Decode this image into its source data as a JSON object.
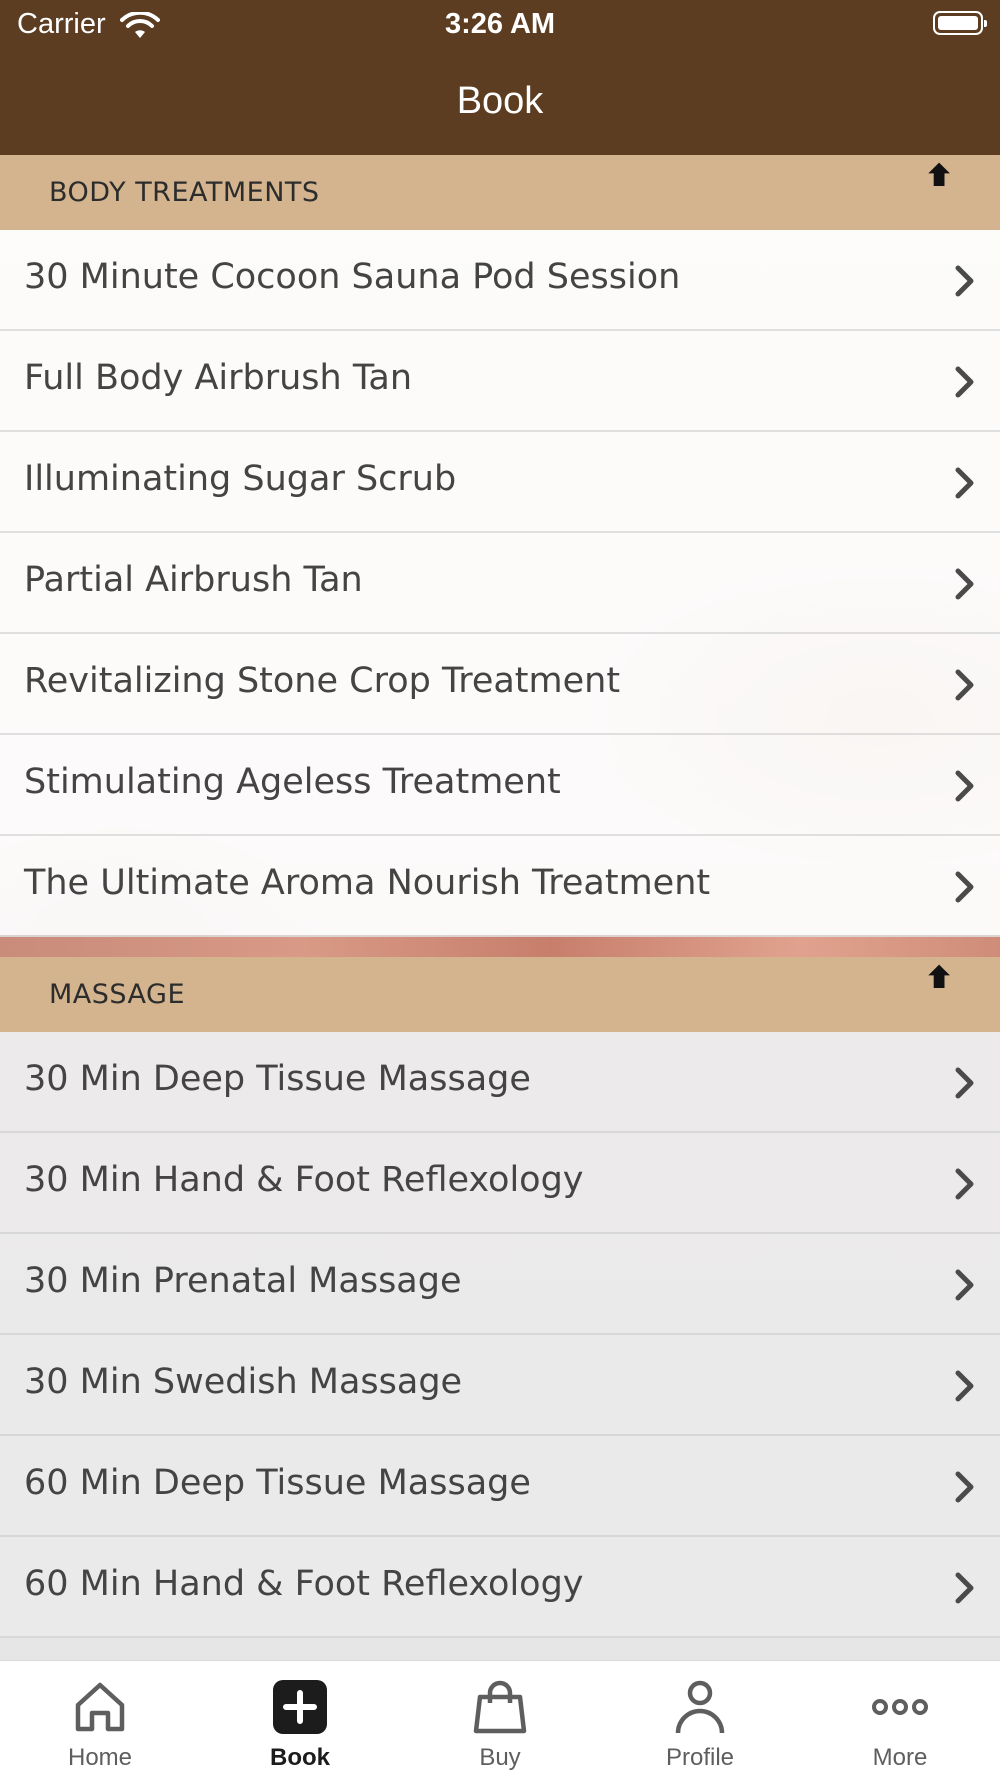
{
  "status_bar": {
    "carrier": "Carrier",
    "time": "3:26 AM"
  },
  "nav": {
    "title": "Book"
  },
  "sections": [
    {
      "title": "BODY TREATMENTS",
      "items": [
        "30 Minute Cocoon Sauna Pod Session",
        "Full Body Airbrush Tan",
        "Illuminating Sugar Scrub",
        "Partial Airbrush Tan",
        "Revitalizing Stone Crop Treatment",
        "Stimulating Ageless Treatment",
        "The Ultimate Aroma Nourish Treatment"
      ]
    },
    {
      "title": "MASSAGE",
      "items": [
        "30 Min Deep Tissue Massage",
        "30 Min Hand & Foot Reflexology",
        "30 Min Prenatal Massage",
        "30 Min Swedish Massage",
        "60 Min Deep Tissue Massage",
        "60 Min Hand & Foot Reflexology"
      ]
    }
  ],
  "tabbar": {
    "tabs": [
      {
        "label": "Home",
        "icon": "home-icon"
      },
      {
        "label": "Book",
        "icon": "plus-square-icon",
        "active": true
      },
      {
        "label": "Buy",
        "icon": "shopping-bag-icon"
      },
      {
        "label": "Profile",
        "icon": "person-icon"
      },
      {
        "label": "More",
        "icon": "ellipsis-icon"
      }
    ]
  },
  "colors": {
    "header_bg": "#5c3d22",
    "section_bg": "#d3b48e",
    "text": "#444444"
  }
}
